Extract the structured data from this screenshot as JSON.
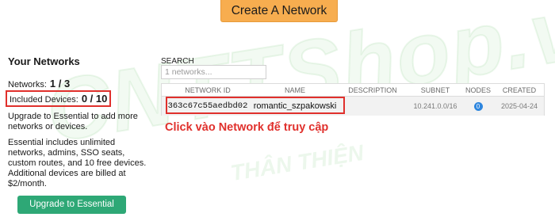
{
  "header": {
    "create_network_label": "Create A Network"
  },
  "sidebar": {
    "title": "Your Networks",
    "networks_label": "Networks:",
    "networks_value": "1 / 3",
    "devices_label": "Included Devices:",
    "devices_value": "0 / 10",
    "upgrade_text": "Upgrade to Essential to add more networks or devices.",
    "includes_text": "Essential includes unlimited networks, admins, SSO seats, custom routes, and 10 free devices. Additional devices are billed at $2/month.",
    "upgrade_button_label": "Upgrade to Essential"
  },
  "search": {
    "label": "SEARCH",
    "placeholder": "1 networks..."
  },
  "table": {
    "headers": [
      "NETWORK ID",
      "NAME",
      "DESCRIPTION",
      "SUBNET",
      "NODES",
      "CREATED"
    ],
    "rows": [
      {
        "id": "363c67c55aedbd02",
        "name": "romantic_szpakowski",
        "description": "",
        "subnet": "10.241.0.0/16",
        "nodes": "0",
        "created": "2025-04-24"
      }
    ]
  },
  "annotation": {
    "text": "Click vào Network để truy cập",
    "color": "#e0302c"
  },
  "watermark": {
    "brand": "CNTTShop.vn",
    "slogan": "THÂN THIỆN"
  },
  "colors": {
    "create_button": "#f7ad4f",
    "upgrade_button": "#2ea876",
    "highlight": "#e0302c",
    "nodes_badge": "#2e86de"
  }
}
